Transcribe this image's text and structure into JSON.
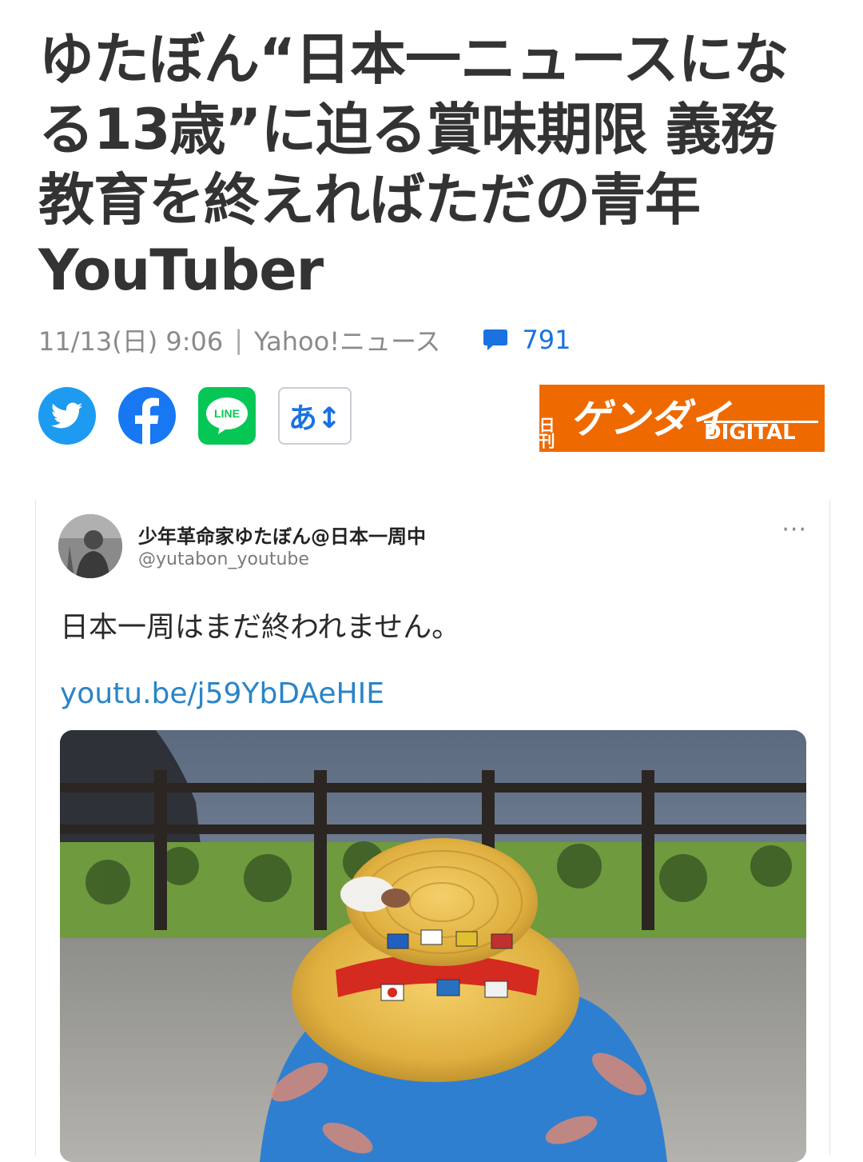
{
  "article": {
    "title": "ゆたぼん“日本一ニュースになる13歳”に迫る賞味期限 義務教育を終えればただの青年YouTuber",
    "date": "11/13(日) 9:06",
    "separator": "|",
    "source": "Yahoo!ニュース",
    "comment_count": "791"
  },
  "share": {
    "twitter_icon": "twitter-bird-icon",
    "facebook_icon": "facebook-f-icon",
    "line_label": "LINE",
    "fontsize_label": "あ↕"
  },
  "publisher": {
    "logo_small": "日刊",
    "logo_main": "ゲンダイ",
    "logo_sub": "DIGITAL",
    "brand_color": "#ee6a00"
  },
  "tweet": {
    "display_name": "少年革命家ゆたぼん@日本一周中",
    "handle": "@yutabon_youtube",
    "more": "···",
    "text": "日本一周はまだ終われません。",
    "link": "youtu.be/j59YbDAeHIE"
  },
  "colors": {
    "accent": "#1a72e0",
    "twitter": "#1d9bf0",
    "facebook": "#1877f2",
    "line": "#06c755",
    "link": "#2a84c8"
  }
}
